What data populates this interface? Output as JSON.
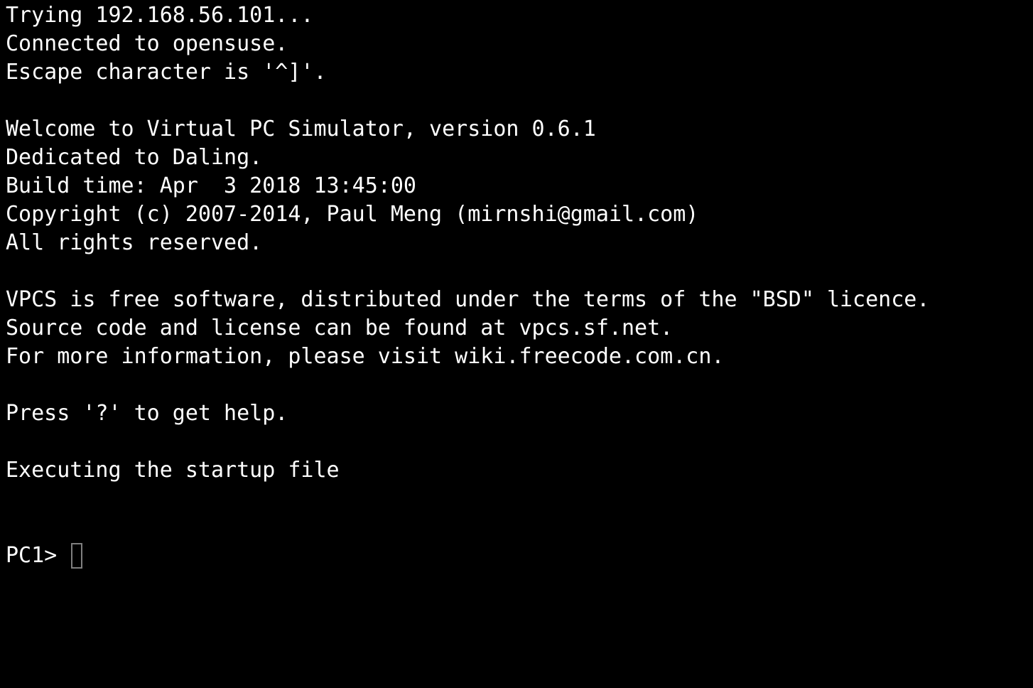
{
  "colors": {
    "background": "#000000",
    "text": "#ffffff",
    "cursor_border": "#7f7f7f"
  },
  "terminal": {
    "lines": [
      "Trying 192.168.56.101...",
      "Connected to opensuse.",
      "Escape character is '^]'.",
      "",
      "Welcome to Virtual PC Simulator, version 0.6.1",
      "Dedicated to Daling.",
      "Build time: Apr  3 2018 13:45:00",
      "Copyright (c) 2007-2014, Paul Meng (mirnshi@gmail.com)",
      "All rights reserved.",
      "",
      "VPCS is free software, distributed under the terms of the \"BSD\" licence.",
      "Source code and license can be found at vpcs.sf.net.",
      "For more information, please visit wiki.freecode.com.cn.",
      "",
      "Press '?' to get help.",
      "",
      "Executing the startup file",
      "",
      ""
    ],
    "prompt": "PC1> ",
    "input_value": ""
  }
}
